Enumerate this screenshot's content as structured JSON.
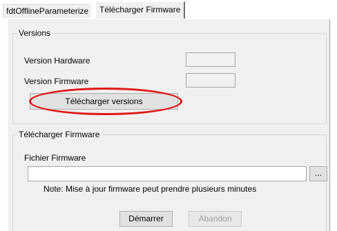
{
  "tabs": [
    {
      "label": "fdtOfflineParameterize",
      "active": false
    },
    {
      "label": "Télécharger Firmware",
      "active": true
    }
  ],
  "versions_group": {
    "title": "Versions",
    "hardware_label": "Version Hardware",
    "hardware_value": "",
    "firmware_label": "Version Firmware",
    "firmware_value": "",
    "download_button": "Télécharger versions"
  },
  "firmware_group": {
    "title": "Télécharger Firmware",
    "file_label": "Fichier Firmware",
    "file_value": "",
    "browse_button": "...",
    "note": "Note: Mise à jour firmware peut prendre plusieurs minutes",
    "start_button": "Démarrer",
    "abort_button": "Abandon"
  },
  "colors": {
    "highlight": "#e01616",
    "panel_background": "#f0f0f0"
  }
}
